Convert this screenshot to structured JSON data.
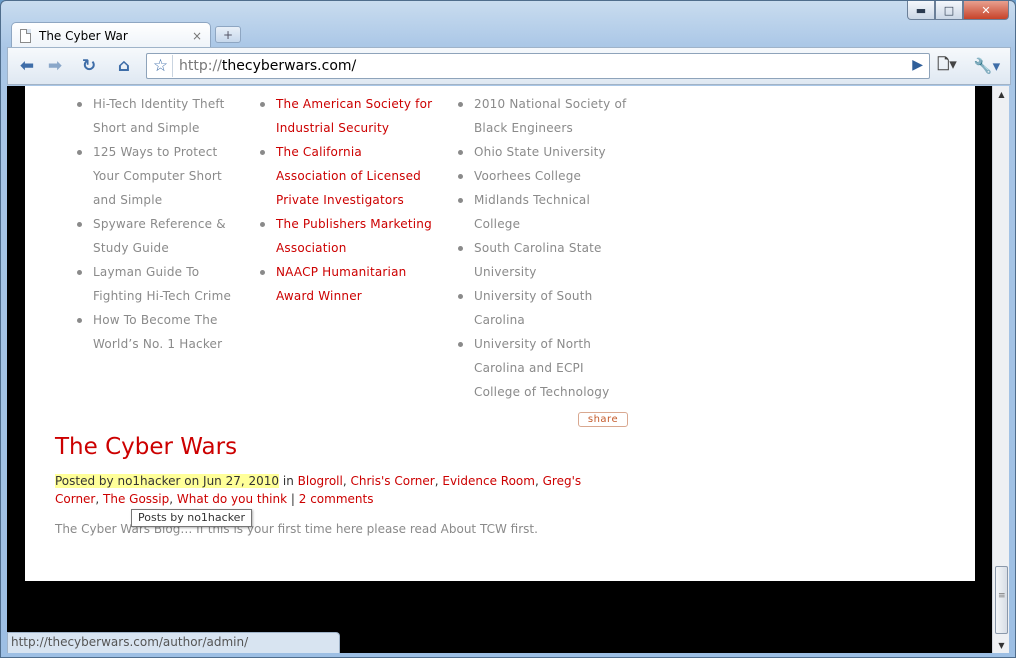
{
  "browser": {
    "tab_title": "The Cyber War",
    "tab_close": "×",
    "new_tab": "+",
    "url_protocol": "http://",
    "url_host": "thecyberwars.com/",
    "status_url": "http://thecyberwars.com/author/admin/",
    "window_controls": {
      "minimize": "▬",
      "maximize": "□",
      "close": "✕"
    }
  },
  "lists": {
    "column1": [
      "Hi-Tech Identity Theft Short and Simple",
      "125 Ways to Protect Your Computer Short and Simple",
      "Spyware Reference & Study Guide",
      "Layman Guide To Fighting Hi-Tech Crime",
      "How To Become The World’s No. 1 Hacker"
    ],
    "column2": [
      "The American Society for Industrial Security",
      "The California Association of Licensed Private Investigators",
      "The Publishers Marketing Association",
      "NAACP Humanitarian Award Winner"
    ],
    "column3": [
      "2010 National Society of Black Engineers",
      "Ohio State University",
      "Voorhees College",
      "Midlands Technical College",
      "South Carolina State University",
      "University of South Carolina",
      "University of North Carolina and ECPI College of Technology"
    ]
  },
  "post": {
    "share_label": "share",
    "title": "The Cyber Wars",
    "posted_by_prefix": "Posted by ",
    "author": "no1hacker",
    "date_prefix": " on ",
    "date": "Jun 27, 2010",
    "in_label": " in ",
    "categories": [
      "Blogroll",
      "Chris's Corner",
      "Evidence Room",
      "Greg's Corner",
      "The Gossip",
      "What do you think"
    ],
    "separator": " | ",
    "comments": "2 comments",
    "tooltip": "Posts by no1hacker",
    "excerpt": "The Cyber Wars Blog… If this is your first time here please read About TCW first."
  },
  "colors": {
    "link_red": "#cc0000",
    "highlight": "#ffff99",
    "muted_text": "#8a8a8a"
  }
}
